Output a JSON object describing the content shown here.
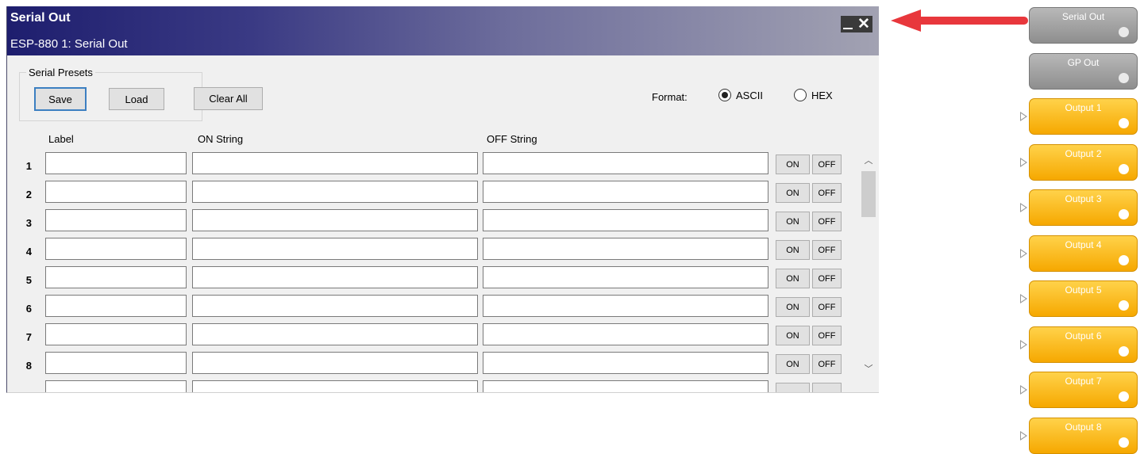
{
  "window": {
    "title": "Serial Out",
    "subtitle": "ESP-880 1: Serial Out"
  },
  "presets": {
    "group_label": "Serial Presets",
    "save_label": "Save",
    "load_label": "Load"
  },
  "clear_all_label": "Clear All",
  "format": {
    "label": "Format:",
    "options": [
      "ASCII",
      "HEX"
    ],
    "selected": "ASCII"
  },
  "columns": {
    "label": "Label",
    "on_string": "ON String",
    "off_string": "OFF String"
  },
  "rows": [
    {
      "num": "1",
      "label": "",
      "on": "",
      "off": ""
    },
    {
      "num": "2",
      "label": "",
      "on": "",
      "off": ""
    },
    {
      "num": "3",
      "label": "",
      "on": "",
      "off": ""
    },
    {
      "num": "4",
      "label": "",
      "on": "",
      "off": ""
    },
    {
      "num": "5",
      "label": "",
      "on": "",
      "off": ""
    },
    {
      "num": "6",
      "label": "",
      "on": "",
      "off": ""
    },
    {
      "num": "7",
      "label": "",
      "on": "",
      "off": ""
    },
    {
      "num": "8",
      "label": "",
      "on": "",
      "off": ""
    }
  ],
  "row_buttons": {
    "on": "ON",
    "off": "OFF"
  },
  "blocks": [
    {
      "label": "Serial Out",
      "style": "gray",
      "has_input": false
    },
    {
      "label": "GP Out",
      "style": "gray",
      "has_input": false
    },
    {
      "label": "Output 1",
      "style": "orange",
      "has_input": true
    },
    {
      "label": "Output 2",
      "style": "orange",
      "has_input": true
    },
    {
      "label": "Output 3",
      "style": "orange",
      "has_input": true
    },
    {
      "label": "Output 4",
      "style": "orange",
      "has_input": true
    },
    {
      "label": "Output 5",
      "style": "orange",
      "has_input": true
    },
    {
      "label": "Output 6",
      "style": "orange",
      "has_input": true
    },
    {
      "label": "Output 7",
      "style": "orange",
      "has_input": true
    },
    {
      "label": "Output 8",
      "style": "orange",
      "has_input": true
    }
  ],
  "colors": {
    "arrow": "#e8373c",
    "title_gradient_start": "#1e1e6e",
    "block_orange": "#f6a800",
    "block_gray": "#9e9e9e"
  }
}
